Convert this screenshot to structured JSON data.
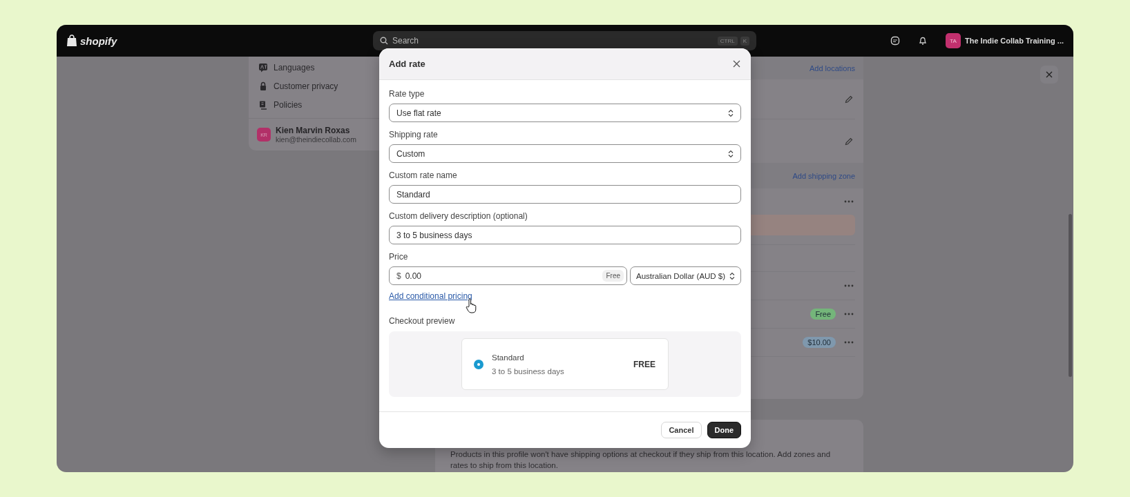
{
  "topbar": {
    "logo": "shopify",
    "search": {
      "placeholder": "Search",
      "keys": [
        "CTRL",
        "K"
      ]
    },
    "store": {
      "initials": "TA",
      "name": "The Indie Collab Training ..."
    }
  },
  "settings_menu": {
    "items": [
      {
        "label": "Languages"
      },
      {
        "label": "Customer privacy"
      },
      {
        "label": "Policies"
      }
    ],
    "user": {
      "initials": "KR",
      "name": "Kien Marvin Roxas",
      "email": "kien@theindiecollab.com"
    }
  },
  "profile_card": {
    "locations_link": "Add locations",
    "zone_link": "Add shipping zone",
    "rates": [
      {
        "label": "Free",
        "color": "#74b57a"
      },
      {
        "label": "$10.00",
        "color": "#7f98ad"
      }
    ]
  },
  "notice": "Products in this profile won't have shipping options at checkout if they ship from this location. Add zones and rates to ship from this location.",
  "modal": {
    "title": "Add rate",
    "fields": [
      {
        "label": "Rate type",
        "kind": "select",
        "value": "Use flat rate"
      },
      {
        "label": "Shipping rate",
        "kind": "select",
        "value": "Custom"
      },
      {
        "label": "Custom rate name",
        "kind": "text",
        "value": "Standard"
      },
      {
        "label": "Custom delivery description (optional)",
        "kind": "text",
        "value": "3 to 5 business days"
      }
    ],
    "price": {
      "label": "Price",
      "prefix": "$",
      "value": "0.00",
      "badge": "Free",
      "currency": "Australian Dollar (AUD $)"
    },
    "link": "Add conditional pricing",
    "preview": {
      "label": "Checkout preview",
      "name": "Standard",
      "description": "3 to 5 business days",
      "price": "FREE",
      "selected": true
    },
    "buttons": [
      {
        "label": "Cancel",
        "kind": "secondary"
      },
      {
        "label": "Done",
        "kind": "primary"
      }
    ]
  }
}
